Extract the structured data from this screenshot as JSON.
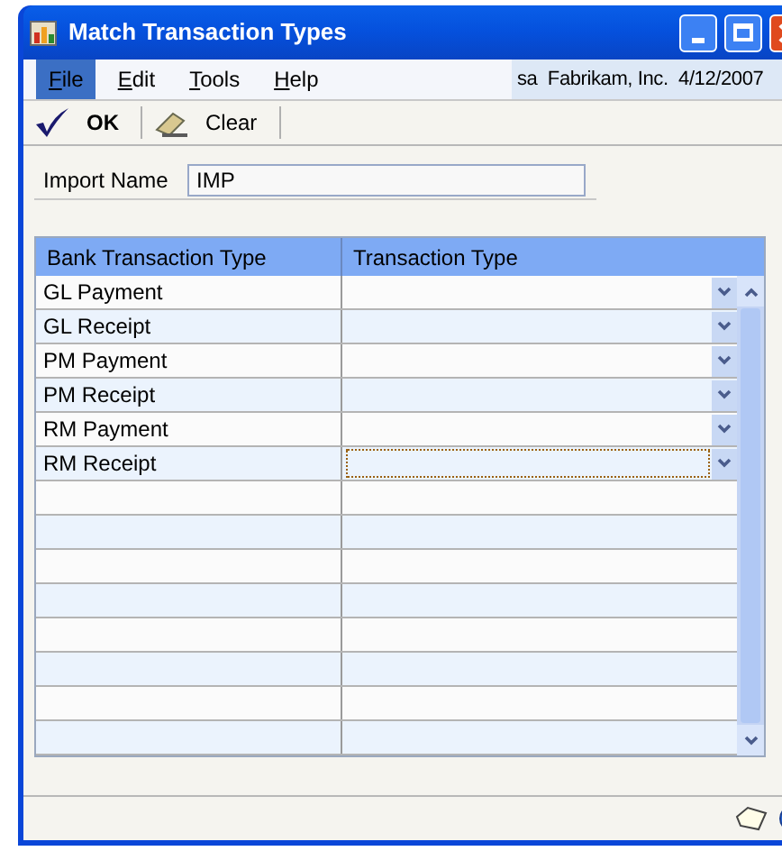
{
  "window": {
    "title": "Match Transaction Types"
  },
  "menu": [
    {
      "label": "File",
      "selected": true
    },
    {
      "label": "Edit",
      "selected": false
    },
    {
      "label": "Tools",
      "selected": false
    },
    {
      "label": "Help",
      "selected": false
    }
  ],
  "company_info": "sa  Fabrikam, Inc.  4/12/2007",
  "toolbar": [
    {
      "label": "OK",
      "kind": "ok"
    },
    {
      "label": "Clear",
      "kind": "clear"
    }
  ],
  "import_name": {
    "label": "Import Name",
    "value": "IMP"
  },
  "table": {
    "columns": [
      "Bank Transaction Type",
      "Transaction Type"
    ],
    "rows": [
      {
        "bank_type": "GL Payment",
        "focused": false
      },
      {
        "bank_type": "GL Receipt",
        "focused": false
      },
      {
        "bank_type": "PM Payment",
        "focused": false
      },
      {
        "bank_type": "PM Receipt",
        "focused": false
      },
      {
        "bank_type": "RM Payment",
        "focused": false
      },
      {
        "bank_type": "RM Receipt",
        "focused": true
      }
    ]
  }
}
